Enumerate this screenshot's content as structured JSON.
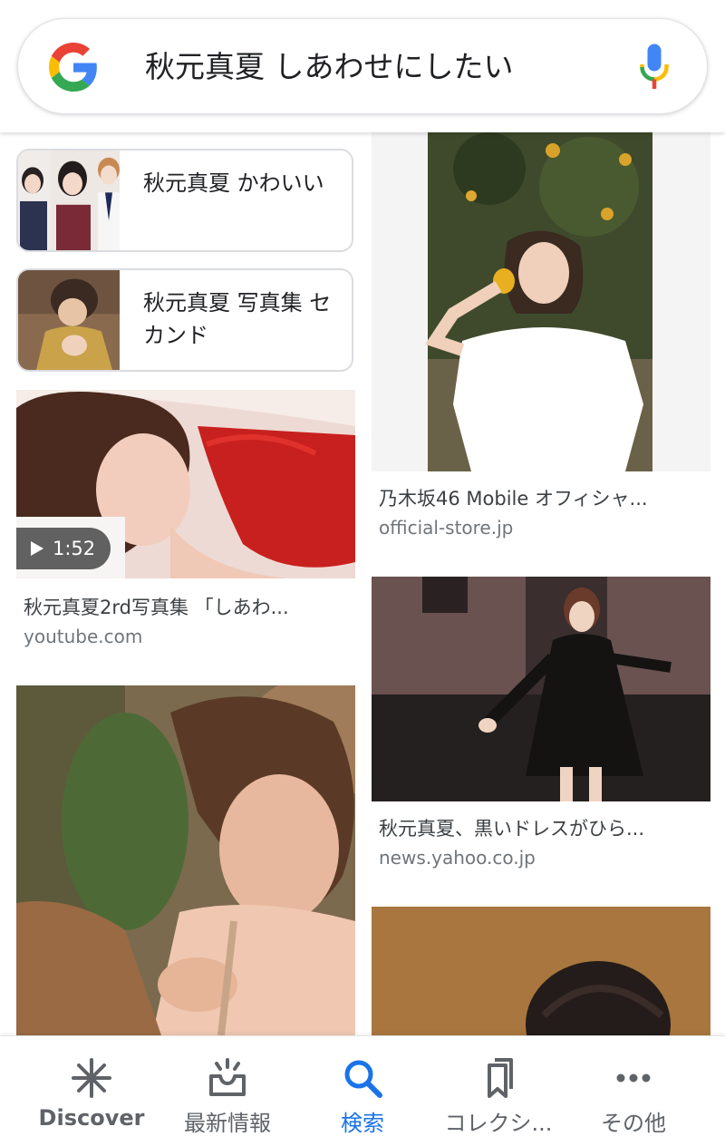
{
  "search": {
    "query": "秋元真夏 しあわせにしたい"
  },
  "related_searches": [
    {
      "label": "秋元真夏 かわいい"
    },
    {
      "label": "秋元真夏 写真集 セカンド"
    }
  ],
  "results": [
    {
      "title": "秋元真夏2rd写真集 「しあわ...",
      "source": "youtube.com",
      "duration": "1:52"
    },
    {
      "title": "乃木坂46 Mobile オフィシャ...",
      "source": "official-store.jp"
    },
    {
      "title": "秋元真夏、黒いドレスがひら...",
      "source": "news.yahoo.co.jp"
    }
  ],
  "bottom_nav": [
    {
      "label": "Discover",
      "icon": "discover-asterisk-icon"
    },
    {
      "label": "最新情報",
      "icon": "updates-tray-icon"
    },
    {
      "label": "検索",
      "icon": "search-icon",
      "active": true
    },
    {
      "label": "コレクシ...",
      "icon": "collections-bookmark-icon"
    },
    {
      "label": "その他",
      "icon": "more-dots-icon"
    }
  ],
  "colors": {
    "active": "#1a73e8",
    "inactive": "#5f6368",
    "google_blue": "#4285F4",
    "google_red": "#EA4335",
    "google_yellow": "#FBBC05",
    "google_green": "#34A853"
  }
}
